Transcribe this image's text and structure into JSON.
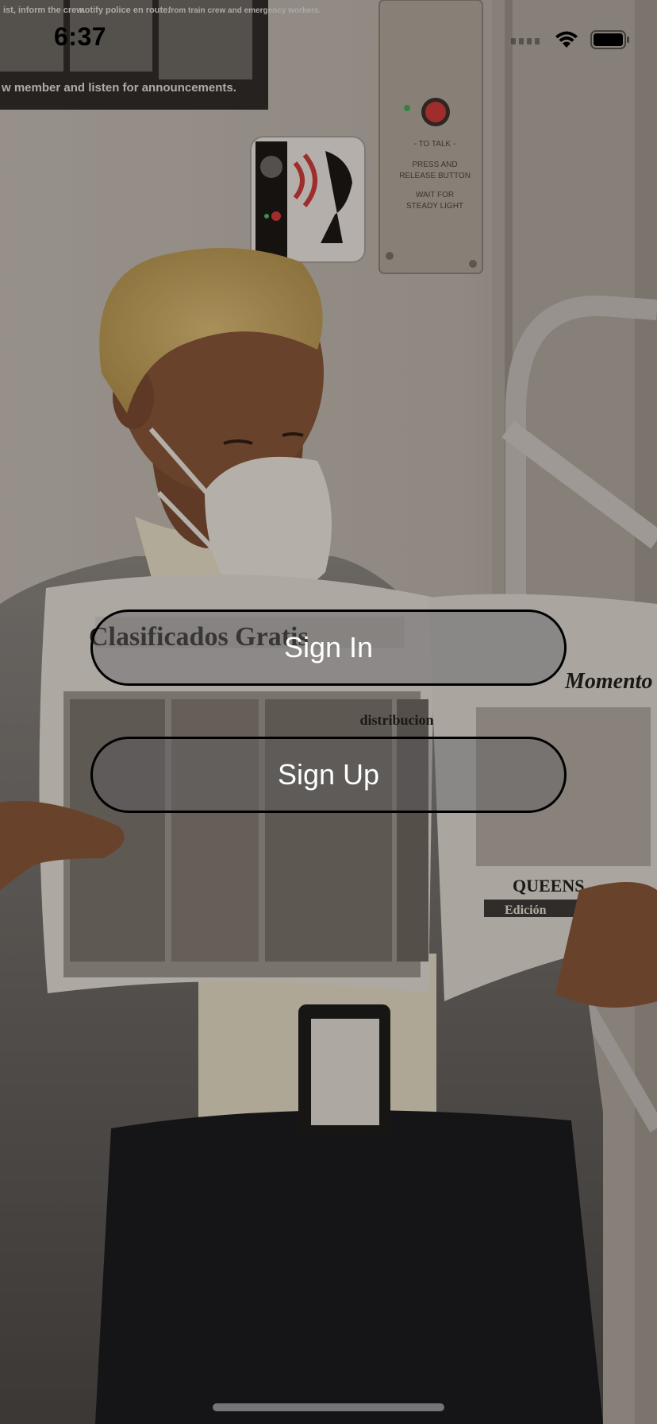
{
  "status_bar": {
    "time": "6:37",
    "icons": [
      "cellular-signal-icon",
      "wifi-icon",
      "battery-icon"
    ]
  },
  "background": {
    "sign_panel_texts": [
      "ist, inform the crew.",
      "notify police en route.",
      "from train crew and emergency workers.",
      "w member and listen for announcements."
    ],
    "intercom_plate": {
      "line1": "- TO TALK -",
      "line2": "PRESS AND",
      "line3": "RELEASE BUTTON",
      "line4": "WAIT FOR",
      "line5": "STEADY LIGHT"
    },
    "newspaper": {
      "left_headline": "Clasificados Gratis",
      "ad_heading": "distribucion",
      "right_headline": "Momento",
      "right_section": "QUEENS",
      "right_edition": "Edición"
    }
  },
  "actions": {
    "sign_in_label": "Sign In",
    "sign_up_label": "Sign Up"
  },
  "colors": {
    "button_border": "#000000",
    "button_text": "#ffffff",
    "status_text": "#000000"
  }
}
